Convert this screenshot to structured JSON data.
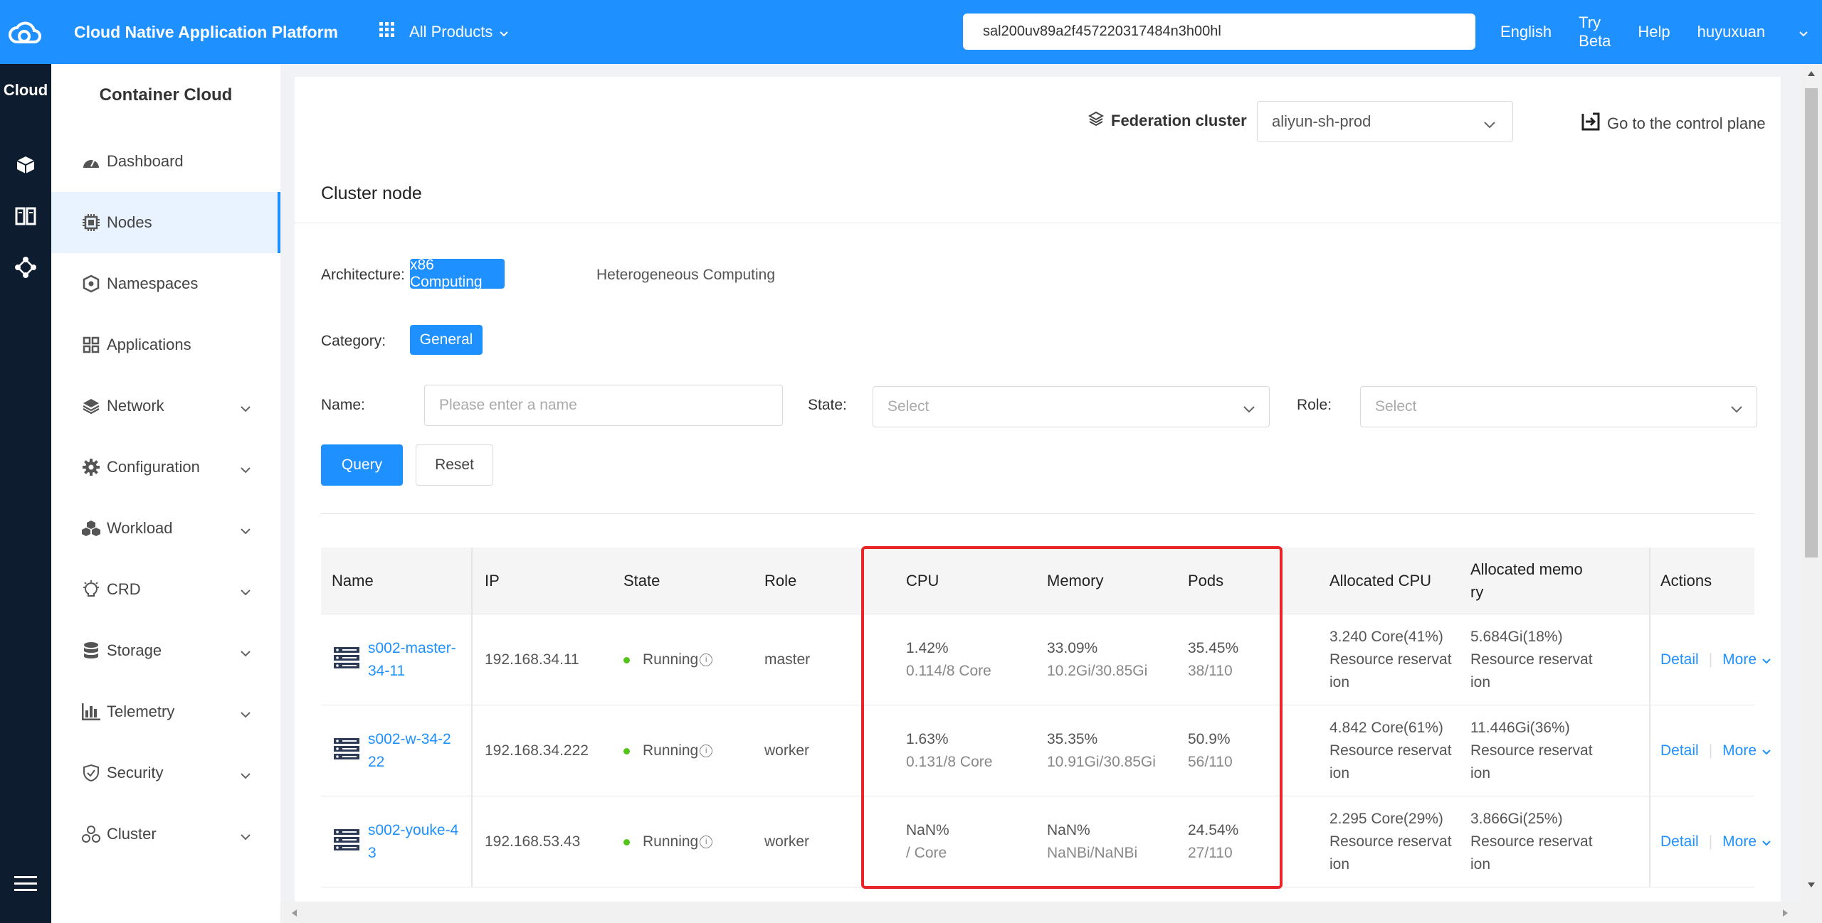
{
  "topbar": {
    "title": "Cloud Native Application Platform",
    "products_label": "All Products",
    "search_value": "sal200uv89a2f457220317484n3h00hl",
    "links": [
      "English",
      "Try Beta",
      "Help",
      "huyuxuan"
    ]
  },
  "rail": {
    "title": "Cloud"
  },
  "sidebar": {
    "title": "Container Cloud",
    "items": [
      {
        "label": "Dashboard",
        "icon": "dashboard-icon",
        "expandable": false
      },
      {
        "label": "Nodes",
        "icon": "chip-icon",
        "expandable": false,
        "active": true
      },
      {
        "label": "Namespaces",
        "icon": "namespace-icon",
        "expandable": false
      },
      {
        "label": "Applications",
        "icon": "apps-icon",
        "expandable": false
      },
      {
        "label": "Network",
        "icon": "layers-icon",
        "expandable": true
      },
      {
        "label": "Configuration",
        "icon": "gear-icon",
        "expandable": true
      },
      {
        "label": "Workload",
        "icon": "cubes-icon",
        "expandable": true
      },
      {
        "label": "CRD",
        "icon": "bulb-icon",
        "expandable": true
      },
      {
        "label": "Storage",
        "icon": "database-icon",
        "expandable": true
      },
      {
        "label": "Telemetry",
        "icon": "bar-chart-icon",
        "expandable": true
      },
      {
        "label": "Security",
        "icon": "shield-icon",
        "expandable": true
      },
      {
        "label": "Cluster",
        "icon": "cluster-icon",
        "expandable": true
      }
    ]
  },
  "federation": {
    "label": "Federation cluster",
    "selected": "aliyun-sh-prod",
    "control_plane": "Go to the control plane"
  },
  "card": {
    "title": "Cluster node",
    "architecture_label": "Architecture:",
    "arch_options": [
      "x86 Computing",
      "Heterogeneous Computing"
    ],
    "category_label": "Category:",
    "category_option": "General",
    "name_label": "Name:",
    "name_placeholder": "Please enter a name",
    "state_label": "State:",
    "state_placeholder": "Select",
    "role_label": "Role:",
    "role_placeholder": "Select",
    "query_button": "Query",
    "reset_button": "Reset"
  },
  "table": {
    "columns": [
      "Name",
      "IP",
      "State",
      "Role",
      "CPU",
      "Memory",
      "Pods",
      "Allocated CPU",
      "Allocated memo\nry",
      "Actions"
    ],
    "rows": [
      {
        "name": [
          "s002-master-",
          "34-11"
        ],
        "ip": "192.168.34.11",
        "state": "Running",
        "role": "master",
        "cpu": "1.42%",
        "cpu_sub": "0.114/8 Core",
        "mem": "33.09%",
        "mem_sub": "10.2Gi/30.85Gi",
        "pods": "35.45%",
        "pods_sub": "38/110",
        "alloc_cpu": [
          "3.240 Core(41%)",
          "Resource reservat",
          "ion"
        ],
        "alloc_mem": [
          "5.684Gi(18%)",
          "Resource reservat",
          "ion"
        ]
      },
      {
        "name": [
          "s002-w-34-2",
          "22"
        ],
        "ip": "192.168.34.222",
        "state": "Running",
        "role": "worker",
        "cpu": "1.63%",
        "cpu_sub": "0.131/8 Core",
        "mem": "35.35%",
        "mem_sub": "10.91Gi/30.85Gi",
        "pods": "50.9%",
        "pods_sub": "56/110",
        "alloc_cpu": [
          "4.842 Core(61%)",
          "Resource reservat",
          "ion"
        ],
        "alloc_mem": [
          "11.446Gi(36%)",
          "Resource reservat",
          "ion"
        ]
      },
      {
        "name": [
          "s002-youke-4",
          "3"
        ],
        "ip": "192.168.53.43",
        "state": "Running",
        "role": "worker",
        "cpu": "NaN%",
        "cpu_sub": "/ Core",
        "mem": "NaN%",
        "mem_sub": "NaNBi/NaNBi",
        "pods": "24.54%",
        "pods_sub": "27/110",
        "alloc_cpu": [
          "2.295 Core(29%)",
          "Resource reservat",
          "ion"
        ],
        "alloc_mem": [
          "3.866Gi(25%)",
          "Resource reservat",
          "ion"
        ]
      }
    ],
    "action_detail": "Detail",
    "action_more": "More"
  },
  "colors": {
    "primary": "#1e90ff",
    "rail": "#0e1c2f",
    "highlight": "#e8262a",
    "running": "#52c41a"
  }
}
